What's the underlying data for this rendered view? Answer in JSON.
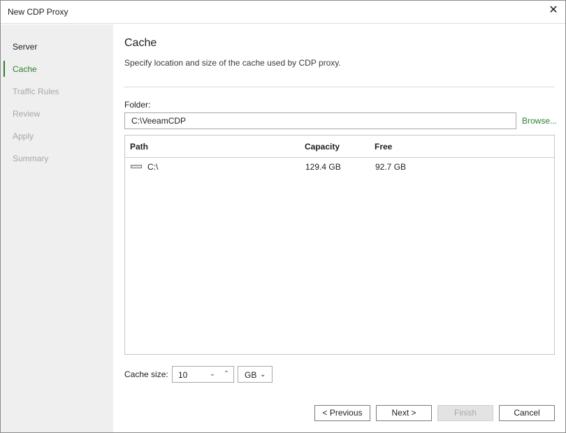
{
  "window": {
    "title": "New CDP Proxy",
    "close_glyph": "✕"
  },
  "sidebar": {
    "steps": [
      {
        "label": "Server",
        "state": "done"
      },
      {
        "label": "Cache",
        "state": "active"
      },
      {
        "label": "Traffic Rules",
        "state": "pending"
      },
      {
        "label": "Review",
        "state": "pending"
      },
      {
        "label": "Apply",
        "state": "pending"
      },
      {
        "label": "Summary",
        "state": "pending"
      }
    ]
  },
  "page": {
    "title": "Cache",
    "description": "Specify location and size of the cache used by CDP proxy."
  },
  "folder": {
    "label": "Folder:",
    "value": "C:\\VeeamCDP",
    "browse_label": "Browse..."
  },
  "volumes": {
    "columns": [
      "Path",
      "Capacity",
      "Free"
    ],
    "rows": [
      {
        "icon": "drive-icon",
        "path": "C:\\",
        "capacity": "129.4 GB",
        "free": "92.7 GB"
      }
    ]
  },
  "cache_size": {
    "label": "Cache size:",
    "value": "10",
    "unit": "GB",
    "down_glyph": "⌄",
    "up_glyph": "⌃",
    "unit_chevron": "⌄"
  },
  "buttons": {
    "previous": "< Previous",
    "next": "Next >",
    "finish": "Finish",
    "cancel": "Cancel"
  },
  "colors": {
    "accent": "#2e7d32",
    "sidebar_bg": "#efefef",
    "disabled_text": "#a8a8a8"
  }
}
